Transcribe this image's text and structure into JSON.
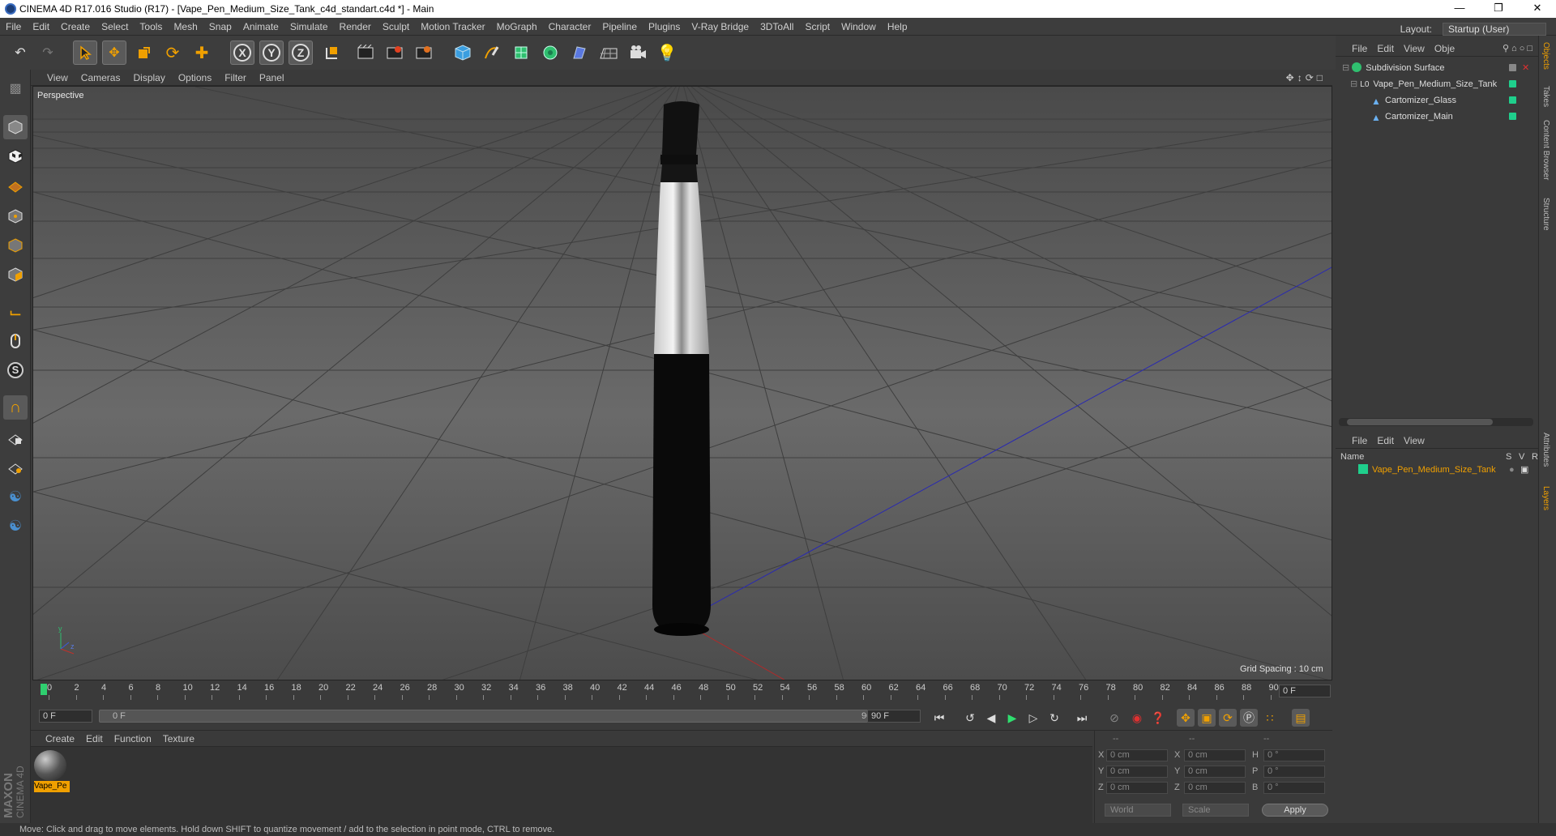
{
  "window": {
    "title": "CINEMA 4D R17.016 Studio (R17) - [Vape_Pen_Medium_Size_Tank_c4d_standart.c4d *] - Main"
  },
  "menubar": [
    "File",
    "Edit",
    "Create",
    "Select",
    "Tools",
    "Mesh",
    "Snap",
    "Animate",
    "Simulate",
    "Render",
    "Sculpt",
    "Motion Tracker",
    "MoGraph",
    "Character",
    "Pipeline",
    "Plugins",
    "V-Ray Bridge",
    "3DToAll",
    "Script",
    "Window",
    "Help"
  ],
  "layout": {
    "label": "Layout:",
    "value": "Startup (User)"
  },
  "viewport": {
    "menu": [
      "View",
      "Cameras",
      "Display",
      "Options",
      "Filter",
      "Panel"
    ],
    "label": "Perspective",
    "grid_spacing": "Grid Spacing : 10 cm"
  },
  "timeline": {
    "ticks": [
      "0",
      "2",
      "4",
      "6",
      "8",
      "10",
      "12",
      "14",
      "16",
      "18",
      "20",
      "22",
      "24",
      "26",
      "28",
      "30",
      "32",
      "34",
      "36",
      "38",
      "40",
      "42",
      "44",
      "46",
      "48",
      "50",
      "52",
      "54",
      "56",
      "58",
      "60",
      "62",
      "64",
      "66",
      "68",
      "70",
      "72",
      "74",
      "76",
      "78",
      "80",
      "82",
      "84",
      "86",
      "88",
      "90"
    ],
    "frame_display": "0 F",
    "start": "0 F",
    "range_start": "0 F",
    "range_end": "90 F",
    "end": "90 F"
  },
  "material_menu": [
    "Create",
    "Edit",
    "Function",
    "Texture"
  ],
  "materials": [
    {
      "name": "Vape_Pe"
    }
  ],
  "coordinates": {
    "header": [
      "--",
      "--",
      "--"
    ],
    "rows": [
      {
        "a": "X",
        "av": "0 cm",
        "b": "X",
        "bv": "0 cm",
        "c": "H",
        "cv": "0 °"
      },
      {
        "a": "Y",
        "av": "0 cm",
        "b": "Y",
        "bv": "0 cm",
        "c": "P",
        "cv": "0 °"
      },
      {
        "a": "Z",
        "av": "0 cm",
        "b": "Z",
        "bv": "0 cm",
        "c": "B",
        "cv": "0 °"
      }
    ],
    "world": "World",
    "scale": "Scale",
    "apply": "Apply"
  },
  "objects_menu": [
    "File",
    "Edit",
    "View",
    "Obje"
  ],
  "objects": [
    {
      "name": "Subdivision Surface"
    },
    {
      "name": "Vape_Pen_Medium_Size_Tank"
    },
    {
      "name": "Cartomizer_Glass"
    },
    {
      "name": "Cartomizer_Main"
    }
  ],
  "layers_menu": [
    "File",
    "Edit",
    "View"
  ],
  "layers_header": {
    "name": "Name",
    "s": "S",
    "v": "V",
    "r": "R"
  },
  "layers": [
    {
      "name": "Vape_Pen_Medium_Size_Tank"
    }
  ],
  "side_tabs": [
    "Objects",
    "Takes",
    "Content Browser",
    "Structure",
    "Attributes",
    "Layers"
  ],
  "status": "Move: Click and drag to move elements. Hold down SHIFT to quantize movement / add to the selection in point mode, CTRL to remove.",
  "brand": [
    "MAXON",
    "CINEMA 4D"
  ],
  "colors": {
    "accent": "#f0a000",
    "layer": "#1fcf8c",
    "axis_x": "#c0302a",
    "axis_z": "#2a3ac0"
  }
}
